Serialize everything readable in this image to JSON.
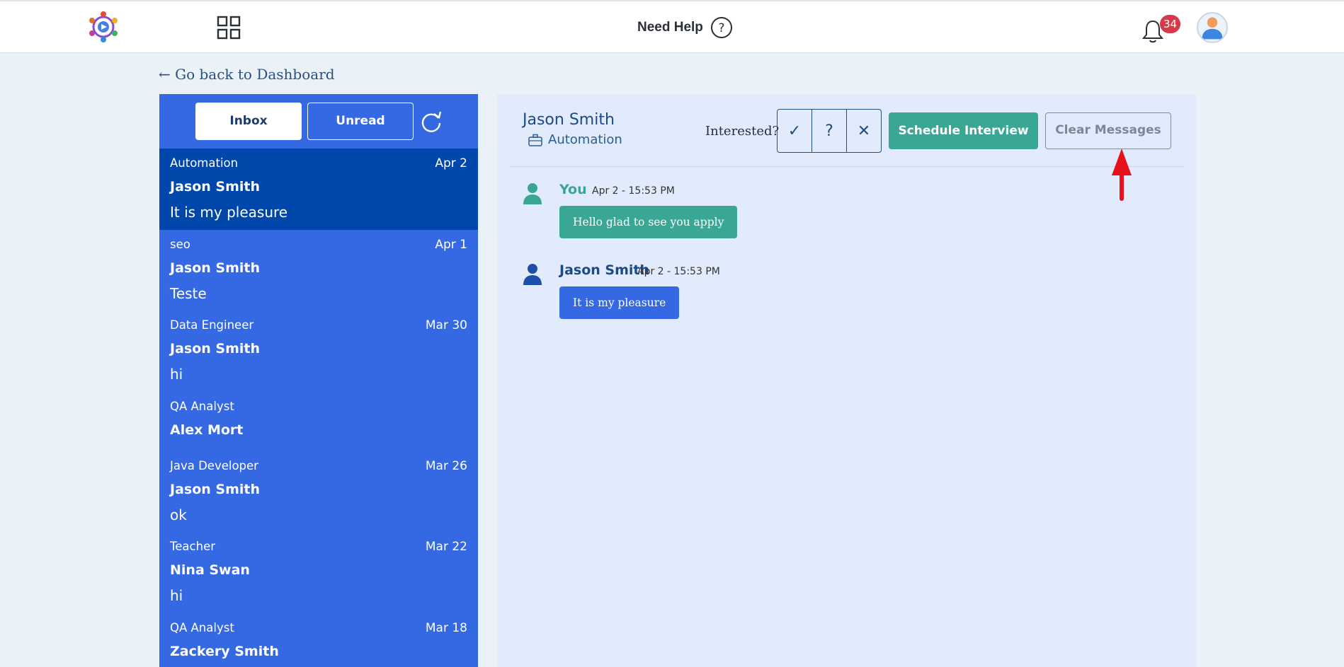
{
  "header": {
    "logo_icon": "app-logo",
    "apps_icon": "grid-icon",
    "help_label": "Need Help",
    "help_icon": "question-circle-icon",
    "notification_icon": "bell-icon",
    "notification_count": "34",
    "avatar_icon": "user-avatar"
  },
  "nav": {
    "back_label": "← Go back to Dashboard"
  },
  "sidebar": {
    "tabs": [
      {
        "label": "Inbox",
        "active": true
      },
      {
        "label": "Unread",
        "active": false
      }
    ],
    "refresh_icon": "refresh-icon",
    "conversations": [
      {
        "job": "Automation",
        "date": "Apr 2",
        "name": "Jason Smith",
        "message": "It is my pleasure",
        "active": true
      },
      {
        "job": "seo",
        "date": "Apr 1",
        "name": "Jason Smith",
        "message": "Teste",
        "active": false
      },
      {
        "job": "Data Engineer",
        "date": "Mar 30",
        "name": "Jason Smith",
        "message": "hi",
        "active": false
      },
      {
        "job": "QA Analyst",
        "date": "",
        "name": "Alex Mort",
        "message": "",
        "active": false
      },
      {
        "job": "Java Developer",
        "date": "Mar 26",
        "name": "Jason Smith",
        "message": "ok",
        "active": false
      },
      {
        "job": "Teacher",
        "date": "Mar 22",
        "name": "Nina Swan",
        "message": "hi",
        "active": false
      },
      {
        "job": "QA Analyst",
        "date": "Mar 18",
        "name": "Zackery Smith",
        "message": "",
        "active": false
      }
    ]
  },
  "chat": {
    "contact_name": "Jason Smith",
    "job_title": "Automation",
    "interested_label": "Interested?",
    "interest_options": [
      {
        "symbol": "✓",
        "icon": "check-icon"
      },
      {
        "symbol": "?",
        "icon": "question-icon"
      },
      {
        "symbol": "✕",
        "icon": "close-icon"
      }
    ],
    "schedule_label": "Schedule Interview",
    "clear_label": "Clear Messages",
    "messages": [
      {
        "author": "You",
        "time": "Apr 2 - 15:53 PM",
        "text": "Hello glad to see you apply",
        "color": "#3aa694"
      },
      {
        "author": "Jason Smith",
        "time": "Apr 2 - 15:53 PM",
        "text": "It is my pleasure",
        "color": "#3568e3"
      }
    ]
  },
  "colors": {
    "sidebar": "#3568e3",
    "sidebar_active": "#0047ab",
    "accent_green": "#3aa694",
    "badge_red": "#d63a4a",
    "annotation_red": "#e8101b"
  }
}
